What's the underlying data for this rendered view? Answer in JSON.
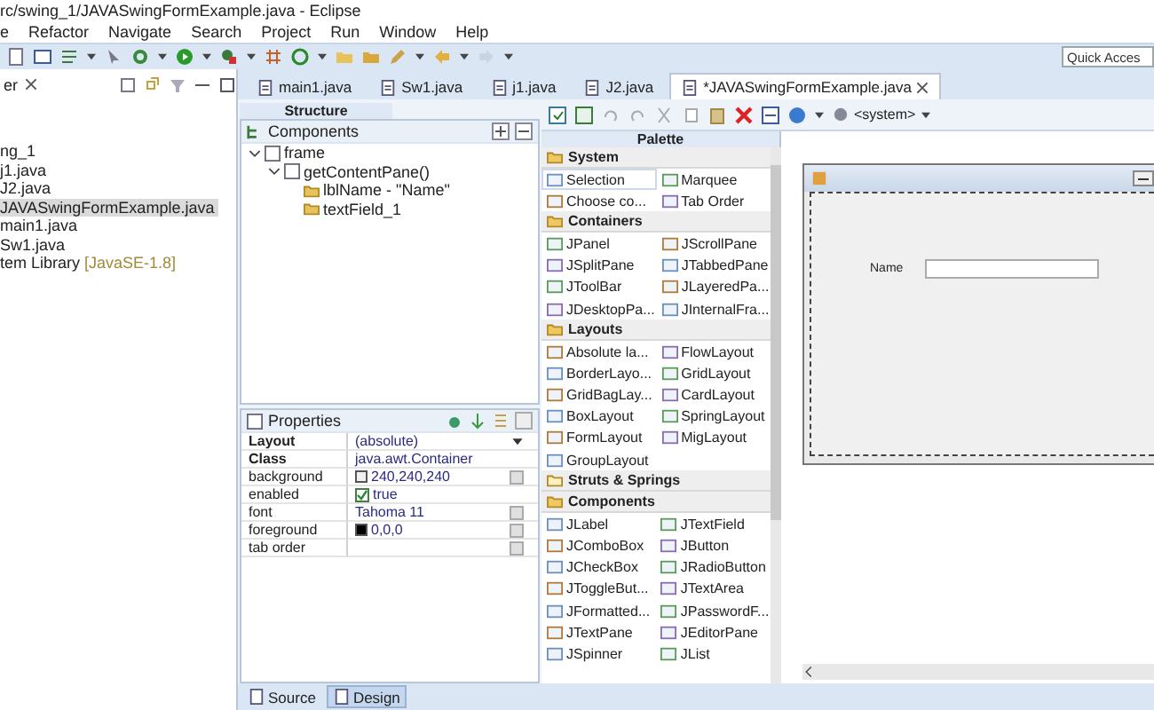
{
  "window": {
    "title": "rc/swing_1/JAVASwingFormExample.java - Eclipse"
  },
  "menu": [
    "e",
    "Refactor",
    "Navigate",
    "Search",
    "Project",
    "Run",
    "Window",
    "Help"
  ],
  "quick_access": {
    "placeholder": "Quick Acces"
  },
  "left_view": {
    "title": "er",
    "items": [
      {
        "label": "ng_1",
        "selected": false
      },
      {
        "label": "j1.java",
        "selected": false
      },
      {
        "label": "J2.java",
        "selected": false
      },
      {
        "label": "JAVASwingFormExample.java",
        "selected": true
      },
      {
        "label": "main1.java",
        "selected": false
      },
      {
        "label": "Sw1.java",
        "selected": false
      },
      {
        "label": "tem Library",
        "decoration": "[JavaSE-1.8]",
        "selected": false
      }
    ]
  },
  "editor_tabs": [
    {
      "label": "main1.java",
      "selected": false
    },
    {
      "label": "Sw1.java",
      "selected": false
    },
    {
      "label": "j1.java",
      "selected": false
    },
    {
      "label": "J2.java",
      "selected": false
    },
    {
      "label": "*JAVASwingFormExample.java",
      "selected": true
    }
  ],
  "structure": {
    "title": "Structure",
    "components_title": "Components",
    "tree": [
      {
        "label": "frame",
        "expanded": true,
        "children": [
          {
            "label": "getContentPane()",
            "expanded": true,
            "children": [
              {
                "label": "lblName - \"Name\""
              },
              {
                "label": "textField_1"
              }
            ]
          }
        ]
      }
    ]
  },
  "properties": {
    "title": "Properties",
    "rows": [
      {
        "name": "Layout",
        "value": "(absolute)",
        "kind": "dropdown",
        "bold": true
      },
      {
        "name": "Class",
        "value": "java.awt.Container",
        "kind": "text",
        "bold": true
      },
      {
        "name": "background",
        "value": "240,240,240",
        "kind": "color",
        "color": "#f0f0f0",
        "bold": false
      },
      {
        "name": "enabled",
        "value": "true",
        "kind": "checkbox",
        "checked": true,
        "bold": false
      },
      {
        "name": "font",
        "value": "Tahoma 11",
        "kind": "button",
        "bold": false
      },
      {
        "name": "foreground",
        "value": "0,0,0",
        "kind": "color",
        "color": "#000000",
        "bold": false
      },
      {
        "name": "tab order",
        "value": "",
        "kind": "button",
        "bold": false
      }
    ]
  },
  "design_toolbar": {
    "system_combo": "<system>"
  },
  "palette": {
    "title": "Palette",
    "categories": [
      {
        "label": "System",
        "expanded": true,
        "items": [
          {
            "label": "Selection",
            "selected": true
          },
          {
            "label": "Marquee",
            "selected": false
          },
          {
            "label": "Choose co...",
            "selected": false
          },
          {
            "label": "Tab Order",
            "selected": false
          }
        ]
      },
      {
        "label": "Containers",
        "expanded": true,
        "items": [
          {
            "label": "JPanel",
            "selected": false
          },
          {
            "label": "JScrollPane",
            "selected": false
          },
          {
            "label": "JSplitPane",
            "selected": false
          },
          {
            "label": "JTabbedPane",
            "selected": false
          },
          {
            "label": "JToolBar",
            "selected": false
          },
          {
            "label": "JLayeredPa...",
            "selected": false
          },
          {
            "label": "JDesktopPa...",
            "selected": false
          },
          {
            "label": "JInternalFra...",
            "selected": false
          }
        ]
      },
      {
        "label": "Layouts",
        "expanded": true,
        "items": [
          {
            "label": "Absolute la...",
            "selected": false
          },
          {
            "label": "FlowLayout",
            "selected": false
          },
          {
            "label": "BorderLayo...",
            "selected": false
          },
          {
            "label": "GridLayout",
            "selected": false
          },
          {
            "label": "GridBagLay...",
            "selected": false
          },
          {
            "label": "CardLayout",
            "selected": false
          },
          {
            "label": "BoxLayout",
            "selected": false
          },
          {
            "label": "SpringLayout",
            "selected": false
          },
          {
            "label": "FormLayout",
            "selected": false
          },
          {
            "label": "MigLayout",
            "selected": false
          },
          {
            "label": "GroupLayout",
            "selected": false
          }
        ]
      },
      {
        "label": "Struts & Springs",
        "expanded": false
      },
      {
        "label": "Components",
        "expanded": true,
        "items": [
          {
            "label": "JLabel",
            "selected": false
          },
          {
            "label": "JTextField",
            "selected": false
          },
          {
            "label": "JComboBox",
            "selected": false
          },
          {
            "label": "JButton",
            "selected": false
          },
          {
            "label": "JCheckBox",
            "selected": false
          },
          {
            "label": "JRadioButton",
            "selected": false
          },
          {
            "label": "JToggleBut...",
            "selected": false
          },
          {
            "label": "JTextArea",
            "selected": false
          },
          {
            "label": "JFormatted...",
            "selected": false
          },
          {
            "label": "JPasswordF...",
            "selected": false
          },
          {
            "label": "JTextPane",
            "selected": false
          },
          {
            "label": "JEditorPane",
            "selected": false
          },
          {
            "label": "JSpinner",
            "selected": false
          },
          {
            "label": "JList",
            "selected": false
          }
        ]
      }
    ]
  },
  "form_preview": {
    "label": "Name"
  },
  "bottom_tabs": [
    {
      "label": "Source",
      "selected": false
    },
    {
      "label": "Design",
      "selected": true
    }
  ]
}
